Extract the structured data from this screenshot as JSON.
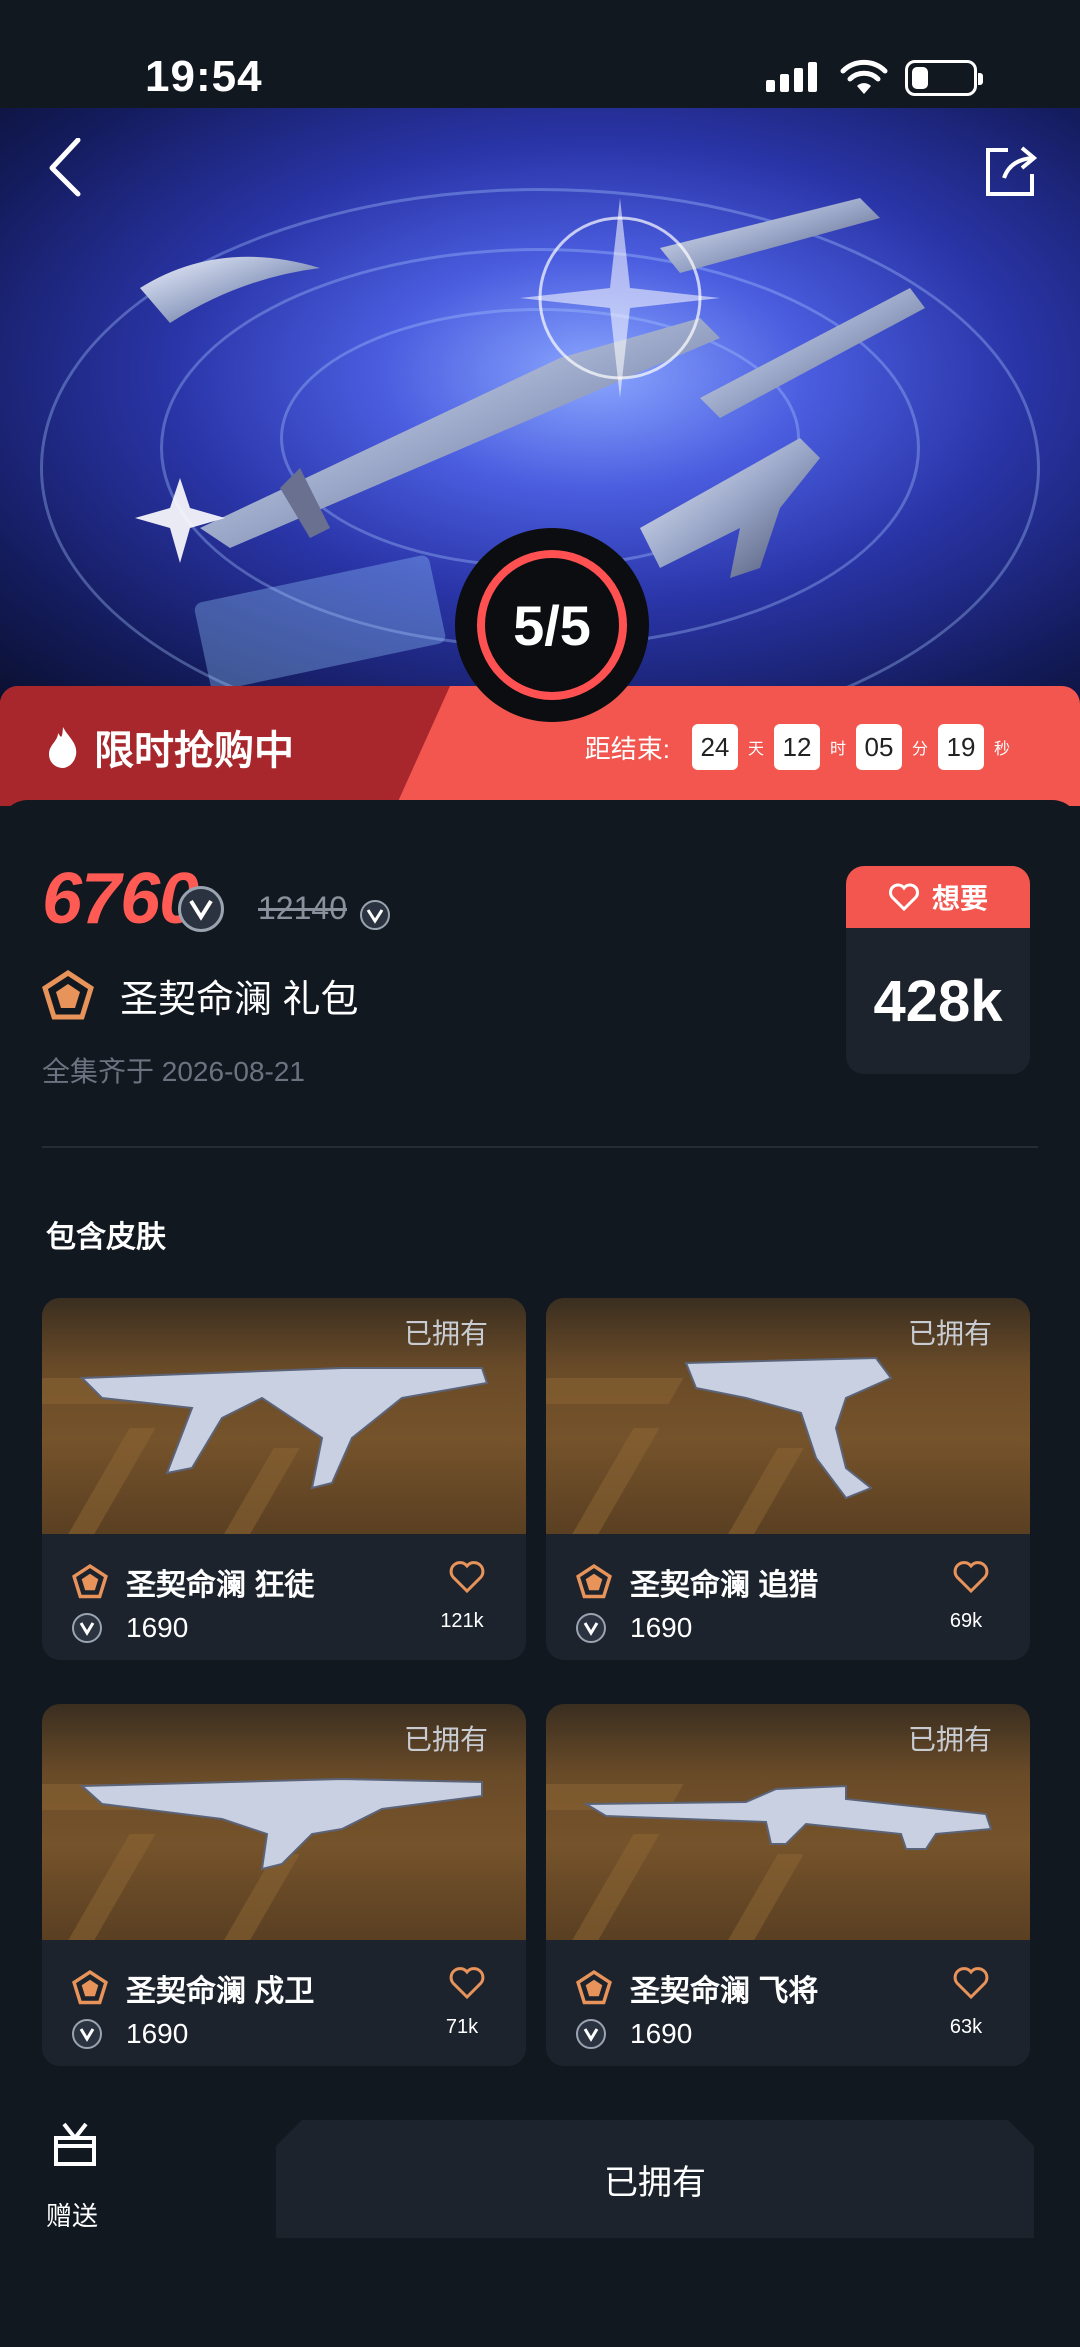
{
  "status_bar": {
    "time": "19:54"
  },
  "hero": {
    "progress": "5/5"
  },
  "sale": {
    "title": "限时抢购中",
    "countdown_label": "距结束:",
    "days": "24",
    "days_unit": "天",
    "hours": "12",
    "hours_unit": "时",
    "minutes": "05",
    "minutes_unit": "分",
    "seconds": "19",
    "seconds_unit": "秒"
  },
  "bundle": {
    "price": "6760",
    "original_price": "12140",
    "name": "圣契命澜 礼包",
    "collect_date": "全集齐于 2026-08-21"
  },
  "want": {
    "label": "想要",
    "count": "428k"
  },
  "section_title": "包含皮肤",
  "skins": [
    {
      "name": "圣契命澜 狂徒",
      "price": "1690",
      "likes": "121k",
      "owned": "已拥有"
    },
    {
      "name": "圣契命澜 追猎",
      "price": "1690",
      "likes": "69k",
      "owned": "已拥有"
    },
    {
      "name": "圣契命澜 戍卫",
      "price": "1690",
      "likes": "71k",
      "owned": "已拥有"
    },
    {
      "name": "圣契命澜 飞将",
      "price": "1690",
      "likes": "63k",
      "owned": "已拥有"
    }
  ],
  "bottom": {
    "gift_label": "赠送",
    "owned_button": "已拥有"
  },
  "colors": {
    "accent_red": "#f2564f",
    "dark_red": "#a8272c",
    "tier_orange": "#e8935a"
  }
}
